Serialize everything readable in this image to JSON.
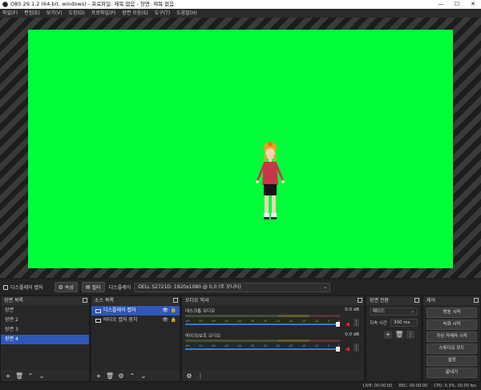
{
  "window": {
    "title": "OBS 29.1.2 (64-bit, windows) - 프로파일: 제목 없음 - 장면: 제목 없음",
    "controls": [
      "—",
      "☐",
      "✕"
    ]
  },
  "menu": [
    "파일(F)",
    "편집(E)",
    "보기(V)",
    "도킹(D)",
    "프로파일(P)",
    "장면 모음(S)",
    "도구(T)",
    "도움말(H)"
  ],
  "controls_bar": {
    "scene_label": "디스플레이 캡처",
    "settings_label": "속성",
    "filters_label": "필터",
    "display_label": "디스플레이",
    "display_value": "DELL S2721D: 1920x1080 @ 0,0 (주 모니터)"
  },
  "docks": {
    "scenes": {
      "title": "장면 목록",
      "items": [
        "장면",
        "장면 2",
        "장면 3",
        "장면 4"
      ],
      "selected": 3
    },
    "sources": {
      "title": "소스 목록",
      "items": [
        "디스플레이 캡처",
        "비디오 캡처 장치"
      ],
      "selected": 0
    },
    "mixer": {
      "title": "오디오 믹서",
      "channels": [
        {
          "name": "데스크톱 오디오",
          "db": "0.0 dB"
        },
        {
          "name": "마이크/보조 오디오",
          "db": "0.0 dB"
        }
      ],
      "scale": [
        "-60",
        "-55",
        "-50",
        "-45",
        "-40",
        "-35",
        "-30",
        "-25",
        "-20",
        "-15",
        "-10",
        "-5",
        "0"
      ]
    },
    "transitions": {
      "title": "장면 전환",
      "type": "페이드",
      "duration_label": "지속 시간",
      "duration": "300 ms"
    },
    "controls": {
      "title": "제어",
      "buttons": [
        "방송 시작",
        "녹화 시작",
        "가상 카메라 시작",
        "스튜디오 모드",
        "설정",
        "끝내기"
      ]
    }
  },
  "status": {
    "live": "LIVE: 00:00:00",
    "rec": "REC: 00:00:00",
    "cpu": "CPU: 0.3%, 30.00 fps"
  },
  "colors": {
    "green_screen": "#00ff3a",
    "selection": "#2f57b8"
  }
}
